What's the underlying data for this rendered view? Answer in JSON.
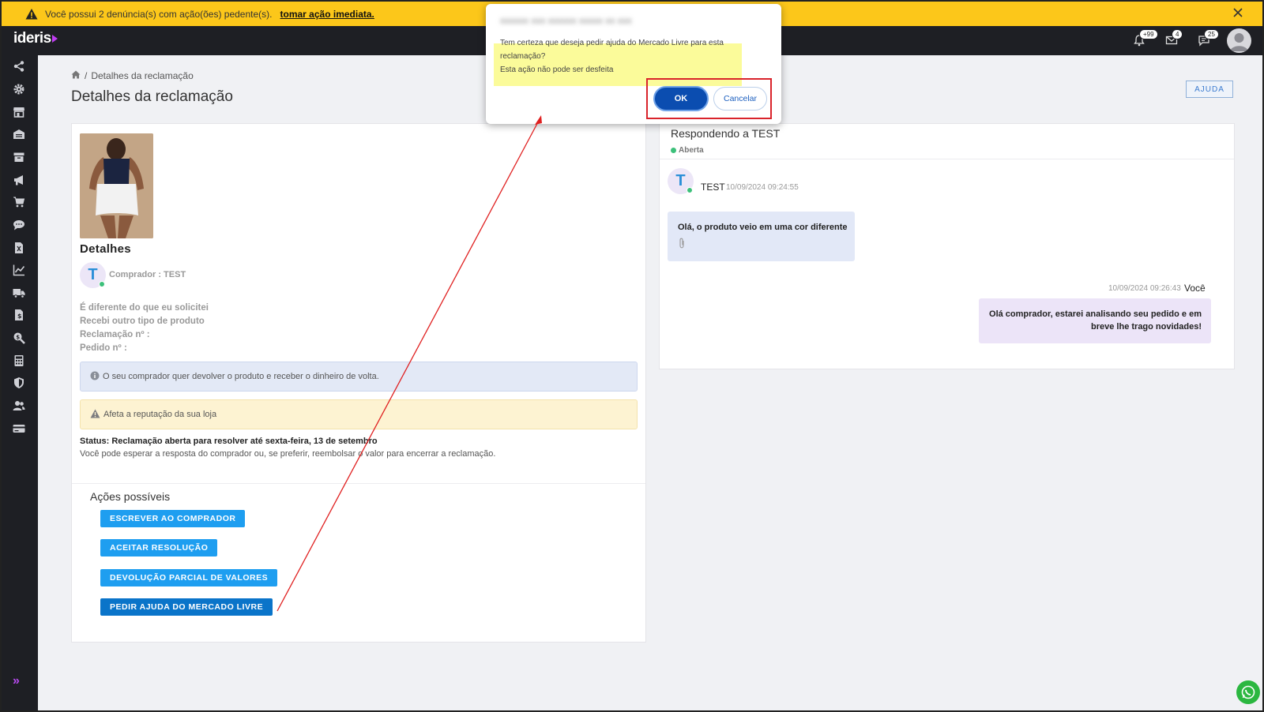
{
  "warning": {
    "text": "Você possui 2 denúncia(s) com ação(ões) pedente(s).",
    "link": "tomar ação imediata."
  },
  "topnav": {
    "logo": "ideris",
    "badges": {
      "notifications": "+99",
      "messages": "4",
      "chat": "25"
    }
  },
  "breadcrumb": {
    "current": "Detalhes da reclamação",
    "separator": "/"
  },
  "page": {
    "title": "Detalhes da reclamação",
    "help_label": "AJUDA"
  },
  "details": {
    "title": "Detalhes",
    "buyer_initial": "T",
    "buyer_label": "Comprador : TEST",
    "lines": [
      "É diferente do que eu solicitei",
      "Recebi outro tipo de produto",
      "Reclamação nº :",
      "Pedido nº :"
    ],
    "alert_info": "O seu comprador quer devolver o produto e receber o dinheiro de volta.",
    "alert_warning": "Afeta a reputação da sua loja",
    "status": "Status: Reclamação aberta para resolver até sexta-feira, 13 de setembro",
    "status_sub": "Você pode esperar a resposta do comprador ou, se preferir, reembolsar o valor para encerrar a reclamação."
  },
  "actions": {
    "title": "Ações possíveis",
    "buttons": [
      "ESCREVER AO COMPRADOR",
      "ACEITAR RESOLUÇÃO",
      "DEVOLUÇÃO PARCIAL DE VALORES",
      "PEDIR AJUDA DO MERCADO LIVRE"
    ]
  },
  "chat": {
    "title": "Respondendo a TEST",
    "status": "Aberta",
    "incoming": {
      "initial": "T",
      "name": "TEST",
      "time": "10/09/2024 09:24:55",
      "text": "Olá, o produto veio em uma cor diferente"
    },
    "outgoing": {
      "time": "10/09/2024 09:26:43",
      "name": "Você",
      "text": "Olá comprador, estarei analisando seu pedido e em breve lhe trago novidades!"
    }
  },
  "modal": {
    "title_blurred": "xxxxxx xxx xxxxxx xxxxx xx xxx",
    "line1": "Tem certeza que deseja pedir ajuda do Mercado Livre para esta",
    "line2": "reclamação?",
    "line3": "Esta ação não pode ser desfeita",
    "ok_label": "OK",
    "cancel_label": "Cancelar"
  },
  "colors": {
    "warning_bar": "#fcc71a",
    "nav_bg": "#1e1f24",
    "action_button": "#1e9ef0",
    "action_button_active": "#0a74c9",
    "ok_button": "#0b4db0",
    "annotation_red": "#d9232b",
    "status_green": "#3cc07a"
  },
  "sidebar_icons": [
    "share-icon",
    "gear-icon",
    "store-icon",
    "warehouse-icon",
    "box-icon",
    "megaphone-icon",
    "cart-icon",
    "chat-icon",
    "invoice-icon",
    "chart-icon",
    "truck-icon",
    "document-dollar-icon",
    "search-dollar-icon",
    "calculator-icon",
    "shield-icon",
    "users-icon",
    "card-icon"
  ]
}
